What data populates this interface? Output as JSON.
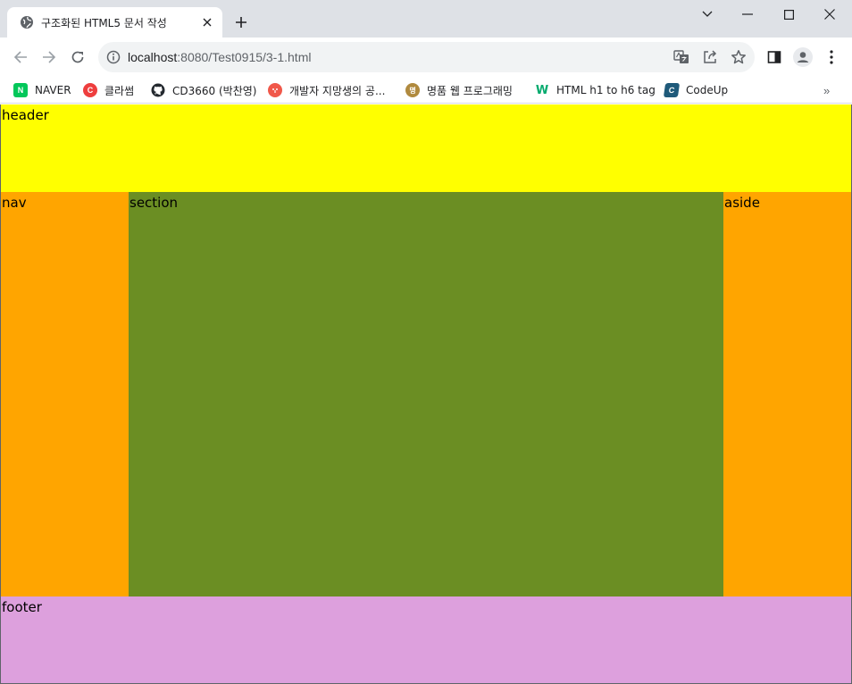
{
  "browser": {
    "tab": {
      "title": "구조화된 HTML5 문서 작성"
    },
    "address": {
      "host": "localhost",
      "path": ":8080/Test0915/3-1.html"
    },
    "bookmarks": [
      {
        "label": "NAVER",
        "icon": "naver-icon",
        "color": "#03c75a",
        "glyph": "N"
      },
      {
        "label": "클라썸",
        "icon": "classum-icon",
        "color": "#ee3e3e",
        "glyph": "C"
      },
      {
        "label": "CD3660 (박찬영)",
        "icon": "github-icon",
        "color": "#24292f",
        "glyph": ""
      },
      {
        "label": "개발자 지망생의 공...",
        "icon": "blog-icon",
        "color": "#f0584a",
        "glyph": ""
      },
      {
        "label": "명품 웹 프로그래밍",
        "icon": "book-icon",
        "color": "#b08a3e",
        "glyph": "명"
      },
      {
        "label": "HTML h1 to h6 tag",
        "icon": "w3schools-icon",
        "color": "#04aa6d",
        "glyph": "W"
      },
      {
        "label": "CodeUp",
        "icon": "codeup-icon",
        "color": "#1f5a7a",
        "glyph": "C"
      }
    ],
    "overflow_label": "»"
  },
  "page": {
    "header": {
      "text": "header",
      "color": "#ffff00"
    },
    "nav": {
      "text": "nav",
      "color": "#ffa500"
    },
    "section": {
      "text": "section",
      "color": "#6b8e23"
    },
    "aside": {
      "text": "aside",
      "color": "#ffa500"
    },
    "footer": {
      "text": "footer",
      "color": "#dda0dd"
    }
  }
}
